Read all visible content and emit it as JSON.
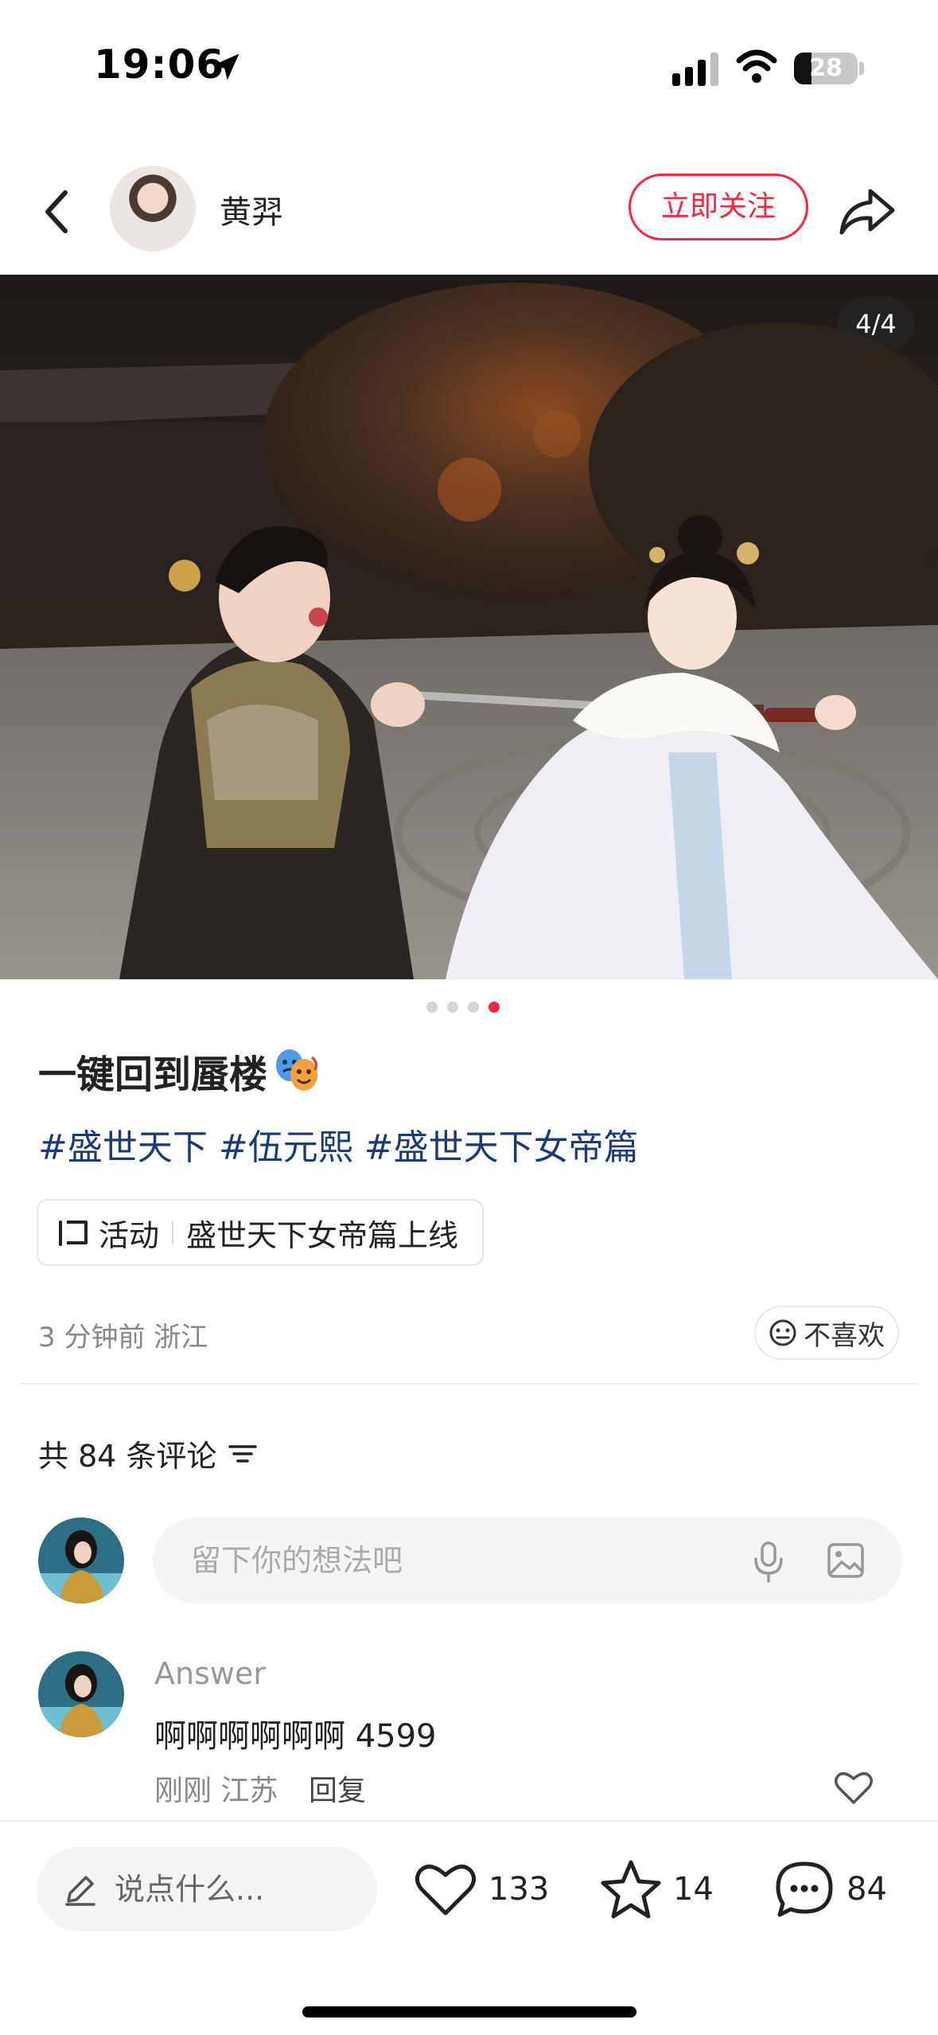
{
  "status_bar": {
    "time": "19:06",
    "battery": "28",
    "battery_level_percent": 28
  },
  "header": {
    "author_name": "黄羿",
    "follow_label": "立即关注",
    "icons": {
      "back": "chevron-left-icon",
      "share": "share-arrow-icon",
      "location": "location-arrow-icon"
    }
  },
  "photo": {
    "counter": "4/4",
    "current_index": 4,
    "total": 4,
    "accent_color": "#ff2442"
  },
  "post": {
    "title": "一键回到蜃楼",
    "title_emoji": "performing-arts-emoji",
    "hashtags": [
      "#盛世天下",
      "#伍元熙",
      "#盛世天下女帝篇"
    ],
    "activity": {
      "label": "活动",
      "text": "盛世天下女帝篇上线"
    },
    "meta": "3 分钟前  浙江",
    "dislike_label": "不喜欢"
  },
  "comments": {
    "count_label": "共 84 条评论",
    "input_placeholder": "留下你的想法吧",
    "items": [
      {
        "user": "Answer",
        "text": "啊啊啊啊啊啊 4599",
        "meta": "刚刚  江苏",
        "reply_label": "回复"
      }
    ]
  },
  "bottom_bar": {
    "say_placeholder": "说点什么...",
    "likes": "133",
    "favorites": "14",
    "comments": "84"
  }
}
